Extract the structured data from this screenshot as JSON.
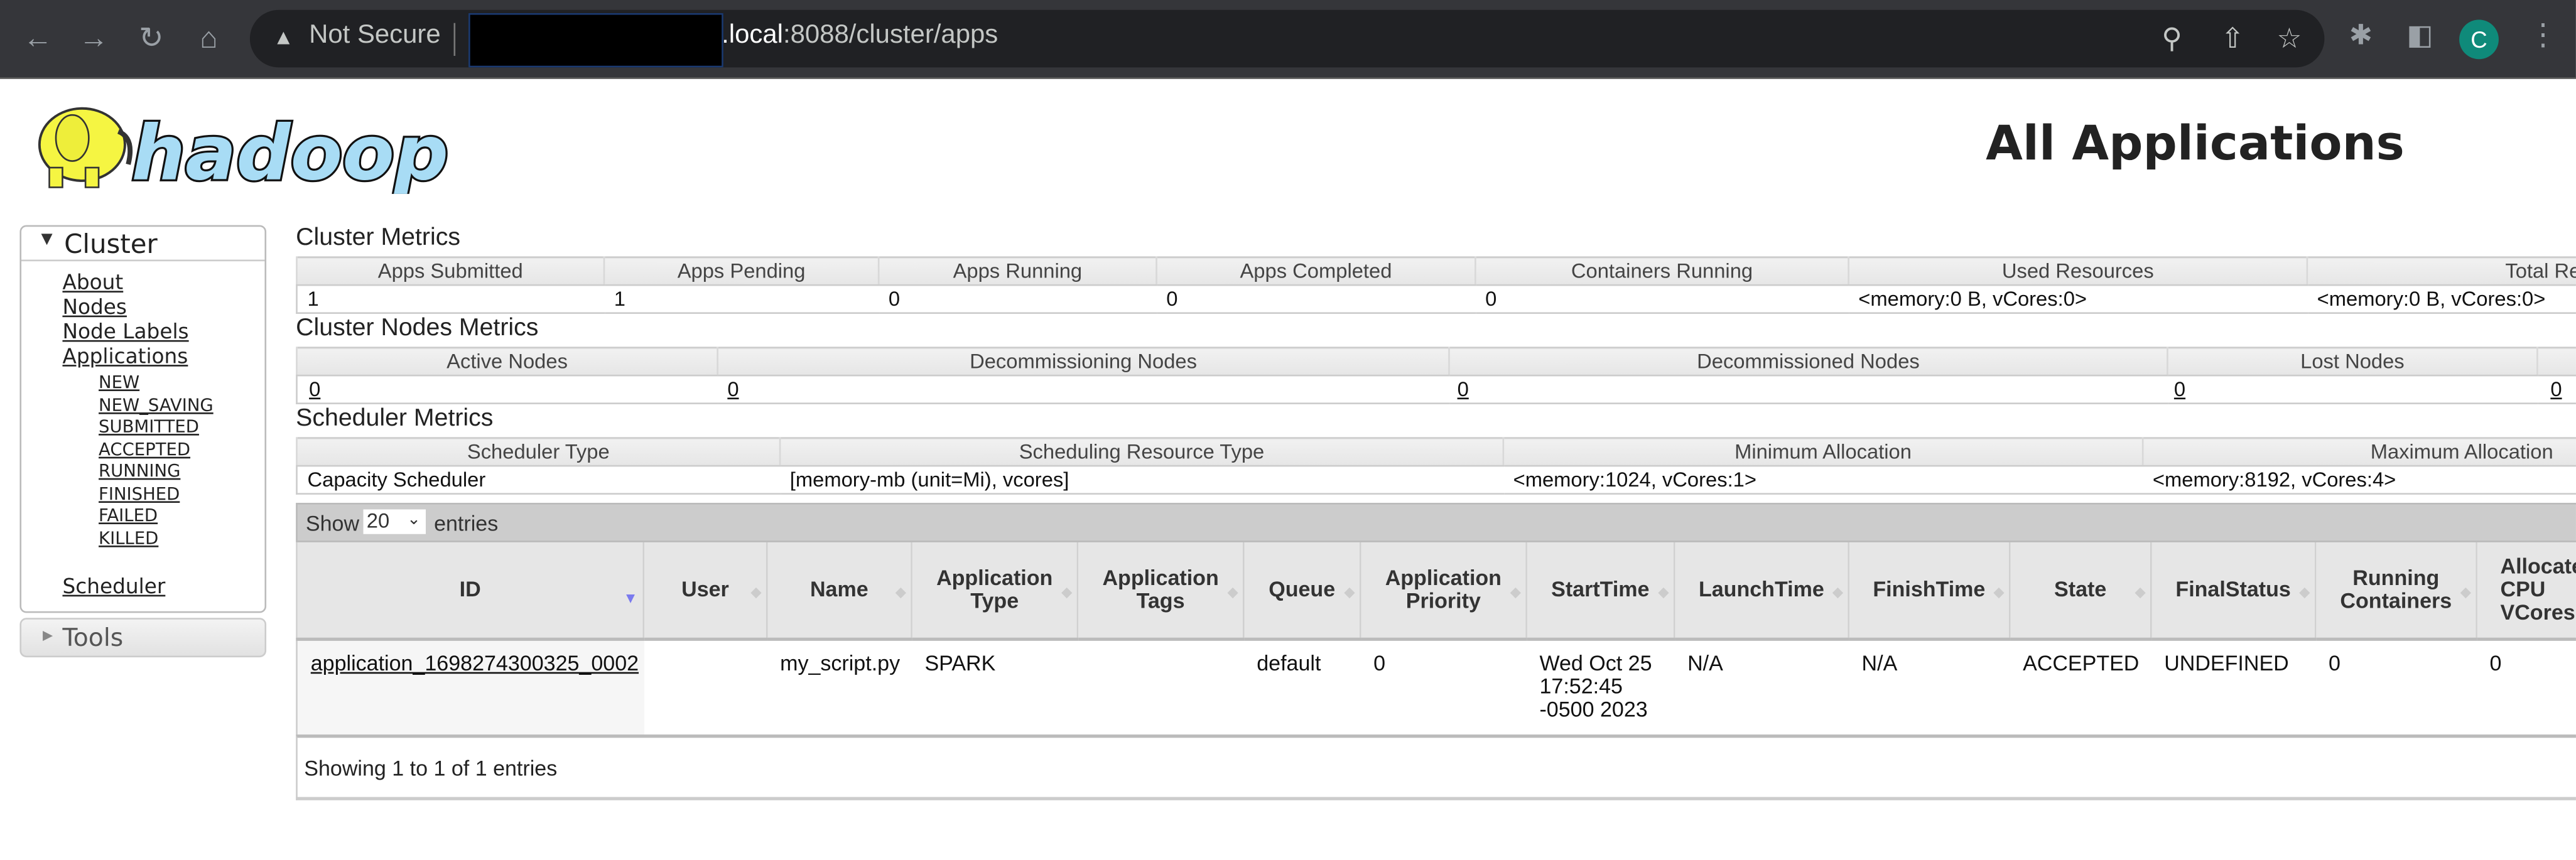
{
  "browser": {
    "security_label": "Not Secure",
    "url_host": ".local",
    "url_path": ":8088/cluster/apps",
    "profile_initial": "C",
    "colors": {
      "chrome_bg": "#35363a",
      "omnibox_bg": "#202124",
      "avatar": "#0f8a7a"
    }
  },
  "header": {
    "logo_text": "hadoop",
    "title": "All Applications"
  },
  "sidebar": {
    "cluster": {
      "label": "Cluster",
      "links": [
        "About",
        "Nodes",
        "Node Labels",
        "Applications"
      ],
      "app_states": [
        "NEW",
        "NEW_SAVING",
        "SUBMITTED",
        "ACCEPTED",
        "RUNNING",
        "FINISHED",
        "FAILED",
        "KILLED"
      ],
      "scheduler": "Scheduler"
    },
    "tools": {
      "label": "Tools"
    }
  },
  "cluster_metrics": {
    "title": "Cluster Metrics",
    "headers": [
      "Apps Submitted",
      "Apps Pending",
      "Apps Running",
      "Apps Completed",
      "Containers Running",
      "Used Resources",
      "Total Resou"
    ],
    "values": [
      "1",
      "1",
      "0",
      "0",
      "0",
      "<memory:0 B, vCores:0>",
      "<memory:0 B, vCores:0>"
    ]
  },
  "nodes_metrics": {
    "title": "Cluster Nodes Metrics",
    "headers": [
      "Active Nodes",
      "Decommissioning Nodes",
      "Decommissioned Nodes",
      "Lost Nodes",
      ""
    ],
    "values": [
      "0",
      "0",
      "0",
      "0",
      "0"
    ]
  },
  "scheduler_metrics": {
    "title": "Scheduler Metrics",
    "headers": [
      "Scheduler Type",
      "Scheduling Resource Type",
      "Minimum Allocation",
      "Maximum Allocation"
    ],
    "values": [
      "Capacity Scheduler",
      "[memory-mb (unit=Mi), vcores]",
      "<memory:1024, vCores:1>",
      "<memory:8192, vCores:4>"
    ]
  },
  "apps_table": {
    "show_label": "Show",
    "page_size": "20",
    "entries_label": "entries",
    "columns": [
      "ID",
      "User",
      "Name",
      "Application Type",
      "Application Tags",
      "Queue",
      "Application Priority",
      "StartTime",
      "LaunchTime",
      "FinishTime",
      "State",
      "FinalStatus",
      "Running Containers",
      "Allocated CPU VCores"
    ],
    "rows": [
      {
        "id": "application_1698274300325_0002",
        "user": "",
        "name": "my_script.py",
        "type": "SPARK",
        "tags": "",
        "queue": "default",
        "priority": "0",
        "start_time": "Wed Oct 25 17:52:45 -0500 2023",
        "launch_time": "N/A",
        "finish_time": "N/A",
        "state": "ACCEPTED",
        "final_status": "UNDEFINED",
        "running_containers": "0",
        "allocated_vcores": "0"
      }
    ],
    "footer": "Showing 1 to 1 of 1 entries",
    "sort_color": "#7a7aee"
  }
}
